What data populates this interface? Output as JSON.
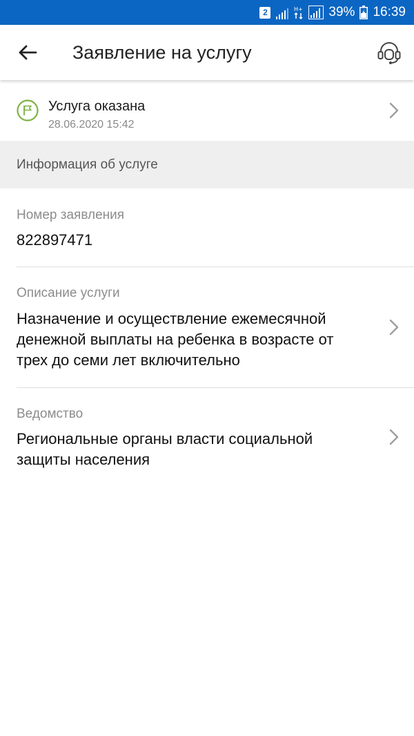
{
  "status_bar": {
    "sim_badge": "2",
    "battery_percent": "39%",
    "time": "16:39"
  },
  "header": {
    "title": "Заявление на услугу",
    "back_icon": "arrow-left-icon",
    "support_icon": "headset-icon"
  },
  "status": {
    "title": "Услуга оказана",
    "date": "28.06.2020 15:42",
    "icon": "flag-icon",
    "icon_color": "#7cb342"
  },
  "section": {
    "title": "Информация об услуге"
  },
  "fields": {
    "application_number": {
      "label": "Номер заявления",
      "value": "822897471"
    },
    "service_description": {
      "label": "Описание услуги",
      "line1": "Назначение и осуществление ежемесячной",
      "line2": "денежной выплаты на ребенка в возрасте от",
      "line3": "трех до семи лет включительно"
    },
    "department": {
      "label": "Ведомство",
      "line1": "Региональные органы власти социальной",
      "line2": "защиты населения"
    }
  },
  "colors": {
    "status_bar": "#0b66c3",
    "section_background": "#efefef"
  }
}
